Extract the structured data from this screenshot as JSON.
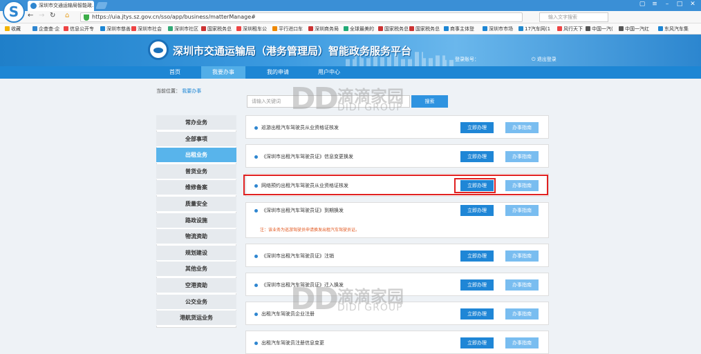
{
  "browser": {
    "tab_title": "深圳市交通运输局智能政...",
    "url": "https://uia.jtys.sz.gov.cn/sso/app/business/matterManage#",
    "search_placeholder": "输入文字搜索",
    "bookmarks": [
      "收藏",
      "企查查·企",
      "信息公开专",
      "深圳市慈善",
      "深圳市社会",
      "深圳市社区",
      "国家税务总",
      "深圳租车公",
      "平行进口车",
      "深圳商务局",
      "全球最美的",
      "国家税务总",
      "国家税务总",
      "商事主体登",
      "深圳市市场",
      "17汽车网(1",
      "风行天下",
      "中国一汽(",
      "中国一汽红",
      "东风汽车集"
    ]
  },
  "site": {
    "title": "深圳市交通运输局（港务管理局）智能政务服务平台",
    "account_label": "登录账号：",
    "logout_label": "退出登录",
    "nav": [
      "首页",
      "我要办事",
      "我的申请",
      "用户中心"
    ],
    "active_nav": "我要办事"
  },
  "breadcrumb": {
    "label": "当前位置：",
    "current": "我要办事"
  },
  "search": {
    "placeholder": "请输入关键词",
    "button": "搜索"
  },
  "sidebar": {
    "items": [
      "常办业务",
      "全部事项",
      "出租业务",
      "普货业务",
      "维修备案",
      "质量安全",
      "路政设施",
      "物流资助",
      "规划建设",
      "其他业务",
      "空港资助",
      "公交业务",
      "港航货运业务"
    ],
    "active": "出租业务"
  },
  "services": [
    {
      "title": "巡游出租汽车驾驶员从业资格证核发",
      "apply": "立即办理",
      "guide": "办事指南",
      "note": ""
    },
    {
      "title": "《深圳市出租汽车驾驶员证》信息变更换发",
      "apply": "立即办理",
      "guide": "办事指南",
      "note": ""
    },
    {
      "title": "网络预约出租汽车驾驶员从业资格证核发",
      "apply": "立即办理",
      "guide": "办事指南",
      "note": ""
    },
    {
      "title": "《深圳市出租汽车驾驶员证》到期换发",
      "apply": "立即办理",
      "guide": "办事指南",
      "note": "注：该业务为巡游驾驶员申请换发出租汽车驾驶员证。"
    },
    {
      "title": "《深圳市出租汽车驾驶员证》注销",
      "apply": "立即办理",
      "guide": "办事指南",
      "note": ""
    },
    {
      "title": "《深圳市出租汽车驾驶员证》迁入换发",
      "apply": "立即办理",
      "guide": "办事指南",
      "note": ""
    },
    {
      "title": "出租汽车驾驶员企业注册",
      "apply": "立即办理",
      "guide": "办事指南",
      "note": ""
    },
    {
      "title": "出租汽车驾驶员注册信息变更",
      "apply": "立即办理",
      "guide": "办事指南",
      "note": ""
    }
  ],
  "watermark": {
    "letters": "DD",
    "cn": "滴滴家园",
    "en": "DIDI GROUP"
  },
  "colors": {
    "nav": "#1d86d4",
    "active_sidebar": "#58b4eb",
    "apply_button": "#1f86d6",
    "guide_button": "#79bdf0",
    "highlight": "#e02020",
    "note": "#e2571e"
  }
}
